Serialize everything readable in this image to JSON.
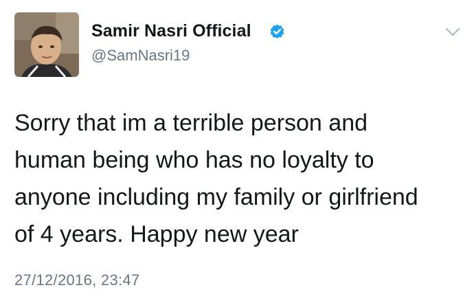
{
  "author": {
    "display_name": "Samir Nasri Official",
    "handle": "@SamNasri19",
    "verified": true
  },
  "icons": {
    "verified": "verified-badge-icon",
    "menu": "chevron-down-icon"
  },
  "tweet": {
    "lines": [
      "Sorry that im a terrible person and",
      "human being who has no loyalty to",
      "anyone including my family or girlfriend",
      "of 4 years. Happy new year"
    ],
    "timestamp": "27/12/2016, 23:47"
  },
  "colors": {
    "text": "#14171a",
    "secondary_text": "#657786",
    "verified_blue": "#1da1f2",
    "chevron": "#aab8c2"
  }
}
